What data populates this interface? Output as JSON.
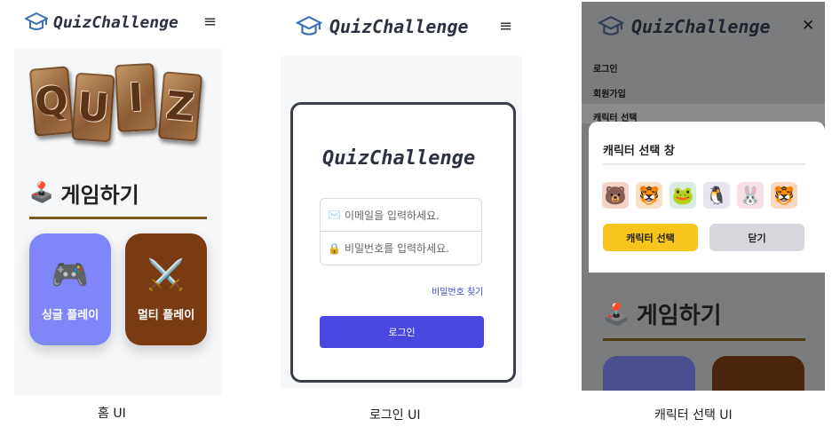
{
  "brand": {
    "name": "QuizChallenge",
    "logo_icon": "graduation-cap-icon",
    "logo_color": "#3b6fb6"
  },
  "home": {
    "menu_icon": "≡",
    "quiz_letters": [
      "Q",
      "U",
      "I",
      "Z"
    ],
    "section_icon": "🕹️",
    "section_title": "게임하기",
    "buttons": [
      {
        "icon": "🎮",
        "label": "싱글 플레이",
        "color": "#7f86f7"
      },
      {
        "icon": "⚔️",
        "label": "멀티 플레이",
        "color": "#7a3a12"
      }
    ],
    "caption": "홈 UI"
  },
  "login": {
    "menu_icon": "≡",
    "card_title": "QuizChallenge",
    "email_icon": "✉️",
    "email_placeholder": "이메일을 입력하세요.",
    "password_icon": "🔒",
    "password_placeholder": "비밀번호를 입력하세요.",
    "find_password": "비밀번호 찾기",
    "login_button": "로그인",
    "accent": "#4a46e0",
    "caption": "로그인 UI"
  },
  "character": {
    "close_icon": "✕",
    "menu": [
      "로그인",
      "회원가입",
      "캐릭터 선택"
    ],
    "modal_title": "캐릭터 선택 창",
    "avatars": [
      "🐻",
      "🐯",
      "🐸",
      "🐧",
      "🐰",
      "🐯"
    ],
    "select_button": "캐릭터 선택",
    "close_button": "닫기",
    "section_icon": "🕹️",
    "section_title": "게임하기",
    "caption": "캐릭터 선택 UI"
  }
}
